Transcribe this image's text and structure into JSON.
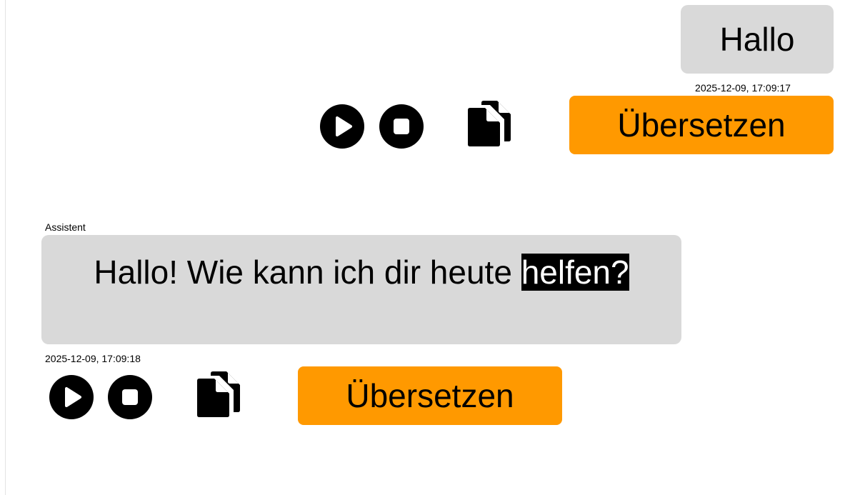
{
  "messages": [
    {
      "role": "user",
      "text": "Hallo",
      "timestamp": "2025-12-09, 17:09:17",
      "translate_label": "Übersetzen"
    },
    {
      "role": "assistant",
      "role_label": "Assistent",
      "text_before": "Hallo! Wie kann ich dir heute ",
      "text_highlighted": "helfen?",
      "timestamp": "2025-12-09, 17:09:18",
      "translate_label": "Übersetzen"
    }
  ],
  "icons": {
    "play": "play-icon",
    "stop": "stop-icon",
    "copy": "copy-icon"
  },
  "colors": {
    "bubble": "#d9d9d9",
    "translate_button": "#ff9900",
    "icon": "#000000",
    "highlight_bg": "#000000",
    "highlight_text": "#ffffff"
  }
}
